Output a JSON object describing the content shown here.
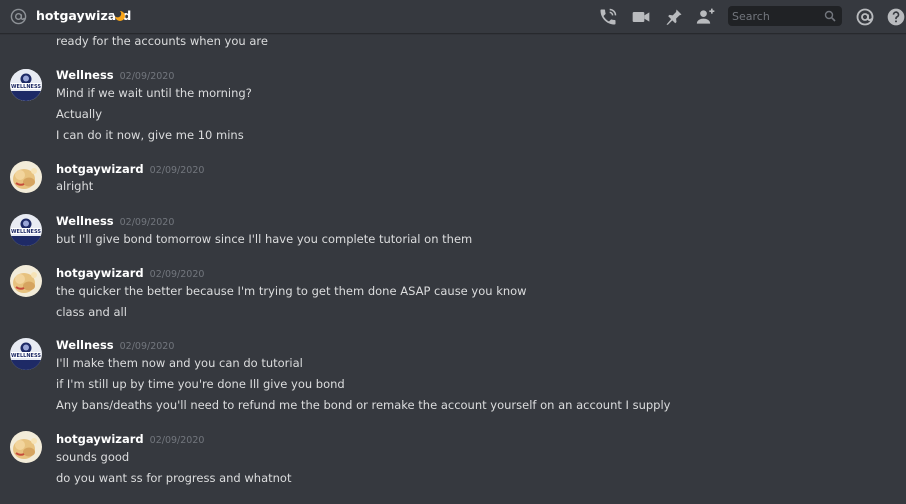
{
  "header": {
    "username": "hotgaywizard",
    "status": "idle",
    "search_placeholder": "Search"
  },
  "icons": {
    "at": "at-icon",
    "moon": "moon-icon",
    "call": "phone-call-icon",
    "video": "video-camera-icon",
    "pin": "pin-icon",
    "add_friend": "add-friend-icon",
    "search": "search-icon",
    "mention": "mention-icon",
    "help": "help-icon"
  },
  "colors": {
    "background": "#36393f",
    "text": "#dcddde",
    "username": "#ffffff",
    "timestamp": "#72767d",
    "status_idle": "#faa61a"
  },
  "messages": [
    {
      "lines": [
        "ready for the accounts when you are"
      ]
    },
    {
      "author": "Wellness",
      "timestamp": "02/09/2020",
      "avatar": "wellness-avatar",
      "lines": [
        "Mind if we wait until the morning?",
        "Actually",
        "I can do it now, give me 10 mins"
      ]
    },
    {
      "author": "hotgaywizard",
      "timestamp": "02/09/2020",
      "avatar": "wizard-avatar",
      "lines": [
        "alright"
      ]
    },
    {
      "author": "Wellness",
      "timestamp": "02/09/2020",
      "avatar": "wellness-avatar",
      "lines": [
        "but I'll give bond tomorrow since I'll have you complete tutorial on them"
      ]
    },
    {
      "author": "hotgaywizard",
      "timestamp": "02/09/2020",
      "avatar": "wizard-avatar",
      "lines": [
        "the quicker the better because I'm trying to get them done ASAP cause you know",
        "class and all"
      ]
    },
    {
      "author": "Wellness",
      "timestamp": "02/09/2020",
      "avatar": "wellness-avatar",
      "lines": [
        "I'll make them now and you can do tutorial",
        "if I'm still up by time you're done Ill give you bond",
        "Any bans/deaths you'll need to refund me the bond or remake the account yourself on an account I supply"
      ]
    },
    {
      "author": "hotgaywizard",
      "timestamp": "02/09/2020",
      "avatar": "wizard-avatar",
      "lines": [
        "sounds good",
        "do you want ss for progress and whatnot"
      ]
    }
  ],
  "wellness_avatar_text": "WELLNESS"
}
